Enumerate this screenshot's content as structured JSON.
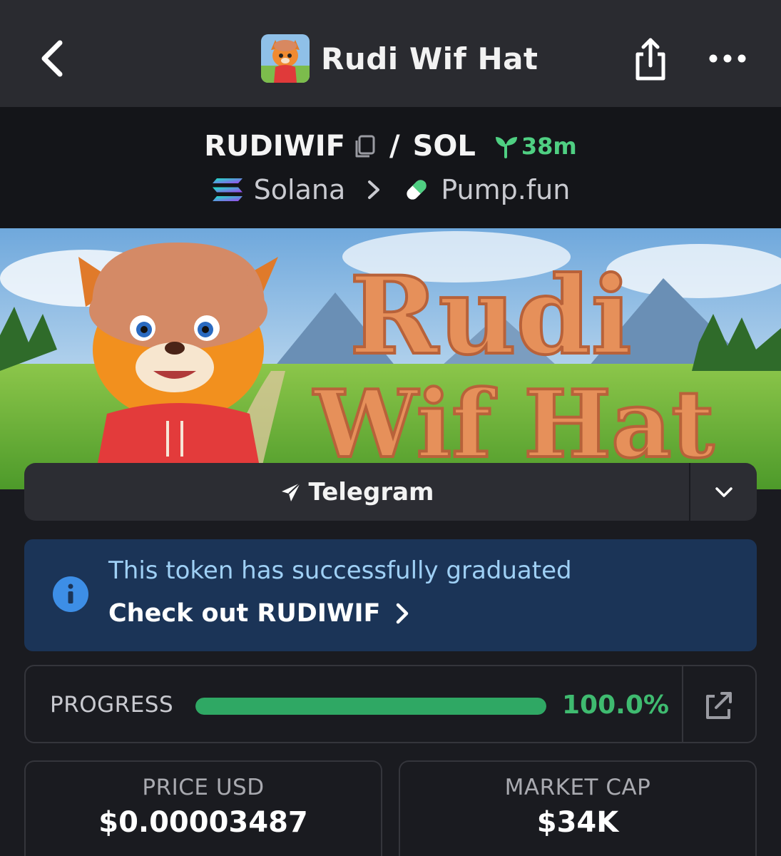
{
  "header": {
    "title": "Rudi Wif Hat"
  },
  "pair": {
    "base": "RUDIWIF",
    "separator": "/",
    "quote": "SOL",
    "age": "38m",
    "chain": "Solana",
    "dex": "Pump.fun"
  },
  "banner": {
    "line1": "Rudi",
    "line2": "Wif Hat"
  },
  "links": {
    "telegram_label": "Telegram"
  },
  "notice": {
    "message": "This token has successfully graduated",
    "cta": "Check out RUDIWIF"
  },
  "progress": {
    "label": "PROGRESS",
    "value_text": "100.0%",
    "fraction": 1.0
  },
  "stats": {
    "price_label": "PRICE USD",
    "price_value": "$0.00003487",
    "mcap_label": "MARKET CAP",
    "mcap_value": "$34K"
  },
  "colors": {
    "accent_green": "#3fbb70",
    "notice_bg": "#1b3457",
    "notice_text": "#9fd0f5"
  },
  "icons": {
    "back": "chevron-left-icon",
    "share": "share-icon",
    "more": "more-horizontal-icon",
    "copy": "copy-icon",
    "age": "sprout-icon",
    "chain": "solana-logo-icon",
    "dex": "pill-icon",
    "telegram": "paper-plane-icon",
    "dropdown": "chevron-down-icon",
    "info": "info-icon",
    "cta": "chevron-right-icon",
    "external": "external-link-icon"
  }
}
